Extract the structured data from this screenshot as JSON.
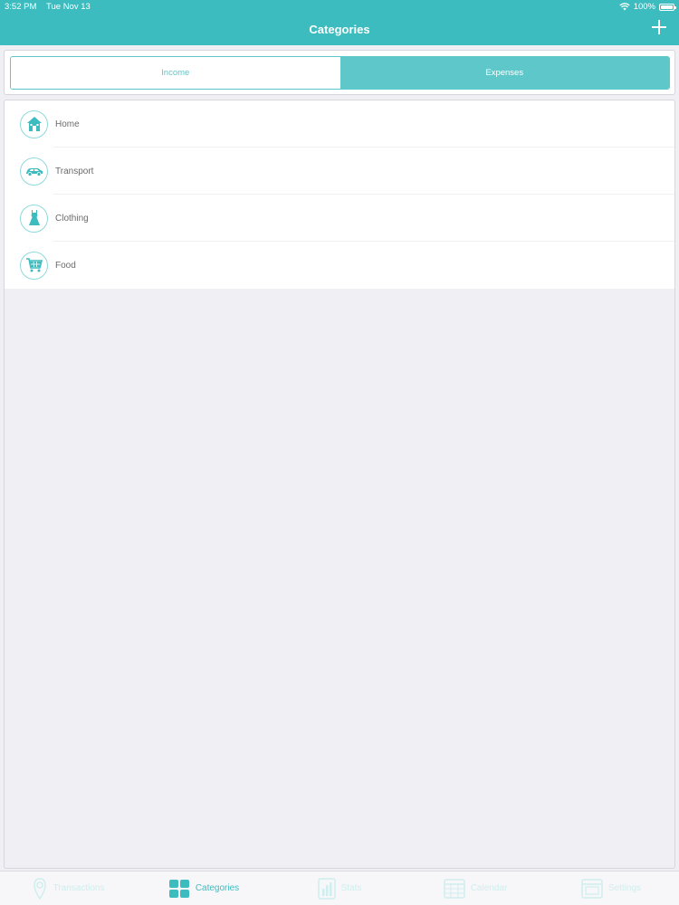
{
  "status_bar": {
    "time": "3:52 PM",
    "date": "Tue Nov 13",
    "battery": "100%"
  },
  "header": {
    "title": "Categories",
    "add_icon": "plus-icon"
  },
  "segments": {
    "income": "Income",
    "expenses": "Expenses",
    "selected": "expenses"
  },
  "categories": [
    {
      "label": "Home",
      "icon": "house-icon"
    },
    {
      "label": "Transport",
      "icon": "car-icon"
    },
    {
      "label": "Clothing",
      "icon": "dress-icon"
    },
    {
      "label": "Food",
      "icon": "shopping-cart-icon"
    }
  ],
  "tabbar": {
    "tabs": [
      {
        "label": "Transactions",
        "icon": "wallet-icon",
        "active": false
      },
      {
        "label": "Categories",
        "icon": "grid-icon",
        "active": true
      },
      {
        "label": "Stats",
        "icon": "chart-icon",
        "active": false
      },
      {
        "label": "Calendar",
        "icon": "calendar-icon",
        "active": false
      },
      {
        "label": "Settings",
        "icon": "settings-icon",
        "active": false
      }
    ]
  },
  "colors": {
    "accent": "#3dbcbf",
    "segment": "#5ec7c9",
    "background": "#f0eff4"
  }
}
